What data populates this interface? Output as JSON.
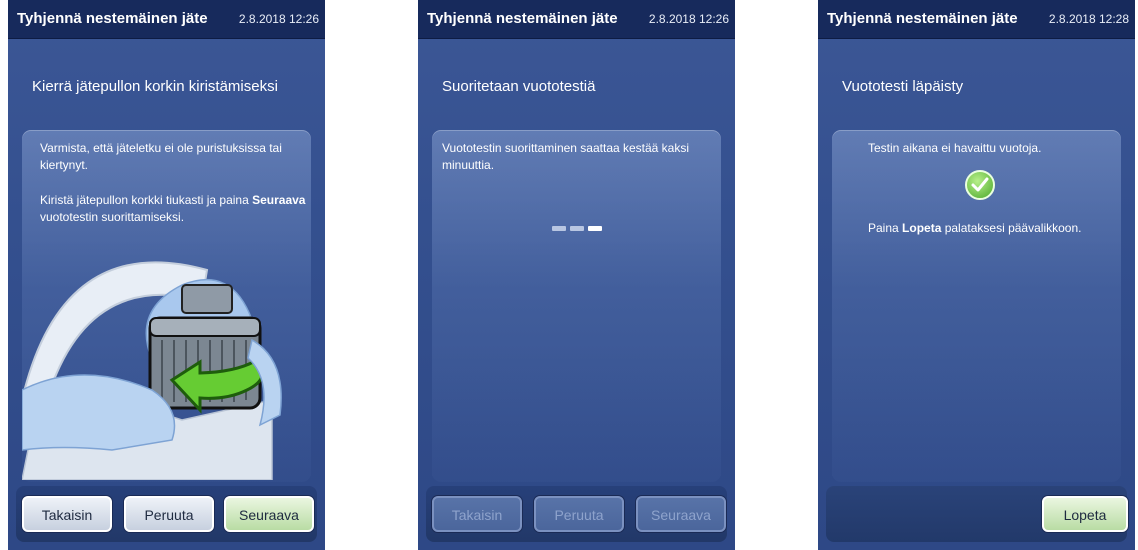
{
  "screens": [
    {
      "title": "Tyhjennä nestemäinen jäte",
      "datetime": "2.8.2018 12:26",
      "heading": "Kierrä jätepullon korkin kiristämiseksi",
      "para1": "Varmista, että jäteletku ei ole puristuksissa tai kiertynyt.",
      "para2_before": "Kiristä jätepullon korkki tiukasti ja paina ",
      "para2_bold": "Seuraava",
      "para2_after": " vuototestin suorittamiseksi.",
      "illustration_icon": "bottle-cap-tighten-icon",
      "buttons": {
        "back": "Takaisin",
        "cancel": "Peruuta",
        "next": "Seuraava"
      }
    },
    {
      "title": "Tyhjennä nestemäinen jäte",
      "datetime": "2.8.2018 12:26",
      "heading": "Suoritetaan vuototestiä",
      "para1": "Vuototestin suorittaminen saattaa kestää kaksi minuuttia.",
      "progress_icon": "progress-dots-icon",
      "progress_step": 3,
      "progress_steps": 3,
      "buttons": {
        "back": "Takaisin",
        "cancel": "Peruuta",
        "next": "Seuraava"
      }
    },
    {
      "title": "Tyhjennä nestemäinen jäte",
      "datetime": "2.8.2018 12:28",
      "heading": "Vuototesti läpäisty",
      "para1": "Testin aikana ei havaittu vuotoja.",
      "check_icon": "checkmark-icon",
      "para2_before": "Paina ",
      "para2_bold": "Lopeta",
      "para2_after": " palataksesi päävalikkoon.",
      "buttons": {
        "finish": "Lopeta"
      }
    }
  ],
  "colors": {
    "screen_bg": "#3c5796",
    "titlebar_bg": "#172a5c",
    "next_button": "#b9dca4",
    "check": "#4aa82a"
  }
}
